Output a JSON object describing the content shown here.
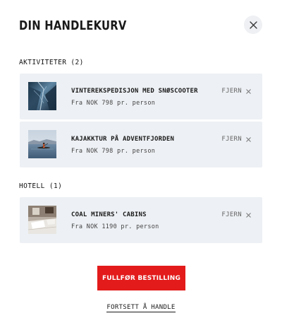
{
  "header": {
    "title": "DIN HANDLEKURV",
    "close_icon": "close-icon"
  },
  "sections": {
    "activities": {
      "label": "AKTIVITETER (2)",
      "items": [
        {
          "name": "VINTEREKSPEDISJON MED SNØSCOOTER",
          "price": "Fra NOK 798 pr. person",
          "remove_label": "FJERN",
          "thumbnail": "ice-cave-photo"
        },
        {
          "name": "KAJAKKTUR PÅ ADVENTFJORDEN",
          "price": "Fra NOK 798 pr. person",
          "remove_label": "FJERN",
          "thumbnail": "kayak-fjord-photo"
        }
      ]
    },
    "hotels": {
      "label": "HOTELL (1)",
      "items": [
        {
          "name": "COAL MINERS' CABINS",
          "price": "Fra NOK 1190 pr. person",
          "remove_label": "FJERN",
          "thumbnail": "hotel-room-photo"
        }
      ]
    }
  },
  "actions": {
    "checkout_label": "FULLFØR BESTILLING",
    "continue_label": "FORTSETT Å HANDLE"
  },
  "colors": {
    "accent": "#e31b1b",
    "card_background": "#edf0f4",
    "close_background": "#eef0f3"
  }
}
